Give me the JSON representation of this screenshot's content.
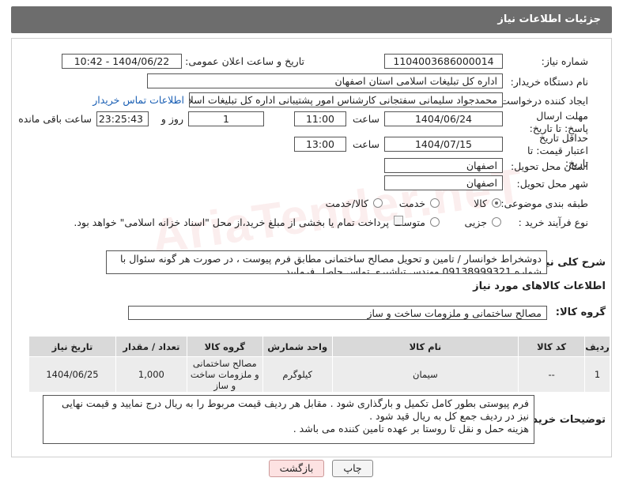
{
  "header": {
    "title": "جزئیات اطلاعات نیاز"
  },
  "fields": {
    "need_number_label": "شماره نیاز:",
    "need_number": "1104003686000014",
    "announce_label": "تاریخ و ساعت اعلان عمومی:",
    "announce_value": "1404/06/22 - 10:42",
    "buyer_org_label": "نام دستگاه خریدار:",
    "buyer_org": "اداره کل تبلیغات اسلامی استان اصفهان",
    "creator_label": "ایجاد کننده درخواست:",
    "creator": "محمدجواد سلیمانی سفتجانی کارشناس امور پشتیبانی اداره کل تبلیغات اسلامی",
    "contact_link": "اطلاعات تماس خریدار",
    "deadline_label": "مهلت ارسال پاسخ: تا تاریخ:",
    "deadline_date": "1404/06/24",
    "time_label": "ساعت",
    "deadline_time": "11:00",
    "days": "1",
    "days_label": "روز و",
    "remaining_time": "23:25:43",
    "remaining_label": "ساعت باقی مانده",
    "validity_label": "حداقل تاریخ اعتبار قیمت: تا تاریخ:",
    "validity_date": "1404/07/15",
    "validity_time": "13:00",
    "province_label": "استان محل تحویل:",
    "province": "اصفهان",
    "city_label": "شهر محل تحویل:",
    "city": "اصفهان",
    "category_label": "طبقه بندی موضوعی:",
    "category_options": [
      "کالا",
      "خدمت",
      "کالا/خدمت"
    ],
    "process_label": "نوع فرآیند خرید :",
    "process_options": [
      "جزیی",
      "متوسط"
    ],
    "payment_note": "پرداخت تمام یا بخشی از مبلغ خرید،از محل \"اسناد خزانه اسلامی\" خواهد بود."
  },
  "description": {
    "label": "شرح کلی نیاز:",
    "text": "دوشخراط خوانسار / تامین و تحویل مصالح ساختمانی مطابق فرم پیوست ، در صورت هر گونه سئوال با شماره 09138999321 مهندس تباشیری تماس حاصل فرمایید"
  },
  "goods": {
    "section_title": "اطلاعات کالاهای مورد نیاز",
    "group_label": "گروه کالا:",
    "group_value": "مصالح ساختمانی و ملزومات ساخت و ساز",
    "columns": [
      "ردیف",
      "کد کالا",
      "نام کالا",
      "واحد شمارش",
      "گروه کالا",
      "تعداد / مقدار",
      "تاریخ نیاز"
    ],
    "rows": [
      {
        "row": "1",
        "code": "--",
        "name": "سیمان",
        "unit": "کیلوگرم",
        "group": "مصالح ساختمانی و ملزومات ساخت و ساز",
        "qty": "1,000",
        "date": "1404/06/25"
      }
    ]
  },
  "buyer_notes": {
    "label": "توضیحات خریدار:",
    "line1": "فرم پیوستی بطور کامل تکمیل و بارگذاری شود . مقابل هر ردیف قیمت مربوط را به ریال درج نمایید و قیمت نهایی نیز در ردیف جمع کل به ریال قید شود .",
    "line2": "هزینه حمل و نقل تا روستا بر عهده تامین کننده می باشد ."
  },
  "buttons": {
    "print": "چاپ",
    "back": "بازگشت"
  },
  "watermark": "AriaTender.neT",
  "colors": {
    "header_bg": "#6d6d6d",
    "link": "#1a5fb4",
    "back_button_bg": "#fde2e2"
  }
}
